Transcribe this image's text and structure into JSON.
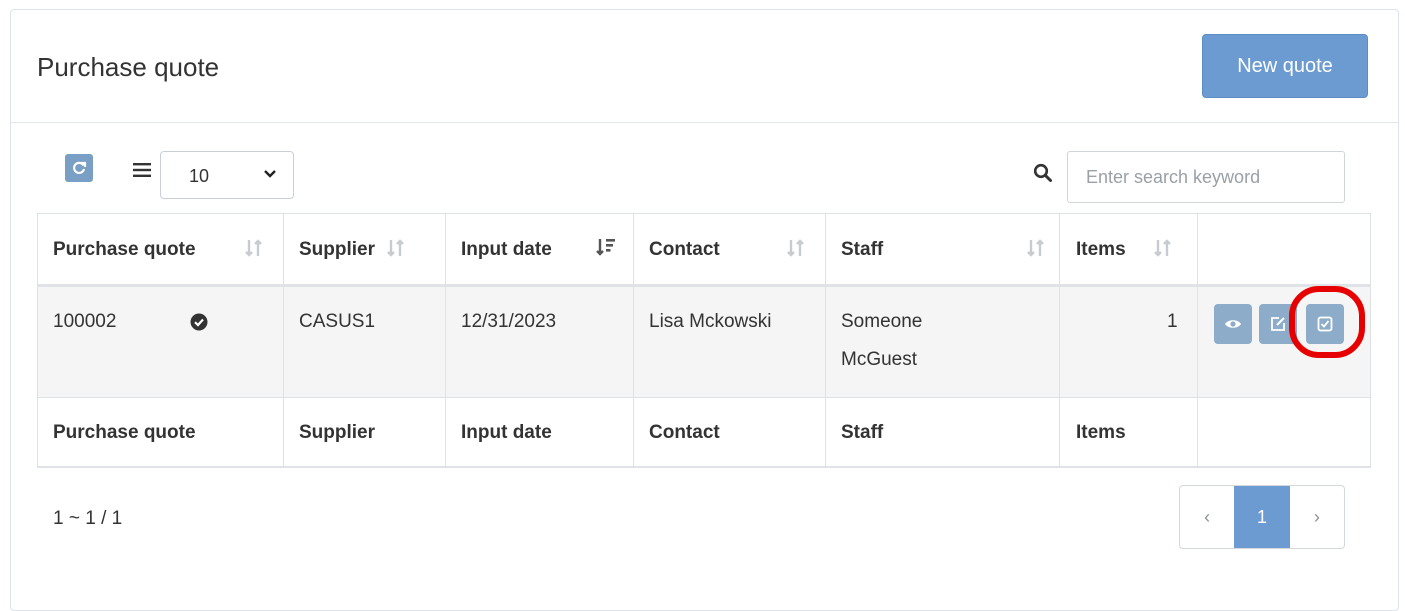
{
  "header": {
    "title": "Purchase quote",
    "new_button_label": "New quote"
  },
  "toolbar": {
    "page_size": "10",
    "search_placeholder": "Enter search keyword"
  },
  "table": {
    "columns": [
      "Purchase quote",
      "Supplier",
      "Input date",
      "Contact",
      "Staff",
      "Items"
    ],
    "rows": [
      {
        "purchase_quote": "100002",
        "supplier": "CASUS1",
        "input_date": "12/31/2023",
        "contact": "Lisa Mckowski",
        "staff_line1": "Someone",
        "staff_line2": "McGuest",
        "items": "1"
      }
    ],
    "footer_columns": [
      "Purchase quote",
      "Supplier",
      "Input date",
      "Contact",
      "Staff",
      "Items"
    ]
  },
  "pagination": {
    "summary": "1 ~ 1 / 1",
    "prev": "‹",
    "current": "1",
    "next": "›"
  },
  "colors": {
    "primary": "#6c9bd2",
    "action_button": "#8cacc9",
    "highlight_ring": "#e60000"
  },
  "icons": {
    "refresh": "refresh-icon",
    "list": "list-icon",
    "search": "search-icon",
    "sort": "sort-icon",
    "status": "check-circle-icon",
    "view": "eye-icon",
    "edit": "edit-icon",
    "confirm": "checkbox-icon"
  }
}
